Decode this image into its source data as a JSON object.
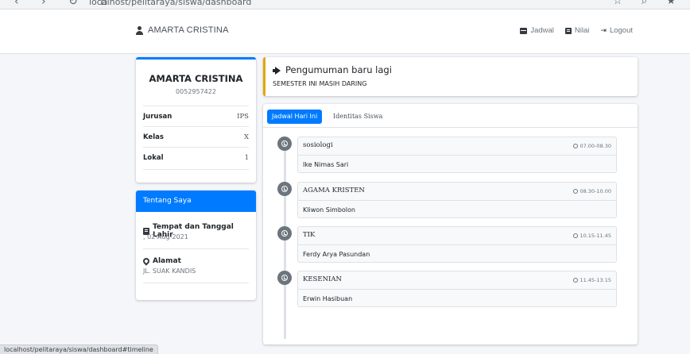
{
  "browser": {
    "nav_icons": "‹ › ↻ ⌂",
    "url": "localhost/pelitaraya/siswa/dashboard",
    "right_icons": "☆ ⌕ ★"
  },
  "navbar": {
    "brand": "AMARTA CRISTINA",
    "links": [
      {
        "label": "Jadwal",
        "icon": "calendar-icon"
      },
      {
        "label": "Nilai",
        "icon": "book-icon"
      },
      {
        "label": "Logout",
        "icon": "logout-icon",
        "glyph": "⇥"
      }
    ]
  },
  "profile": {
    "name": "AMARTA CRISTINA",
    "nis": "0052957422",
    "rows": [
      {
        "key": "Jurusan",
        "value": "IPS"
      },
      {
        "key": "Kelas",
        "value": "X"
      },
      {
        "key": "Lokal",
        "value": "1"
      }
    ]
  },
  "about": {
    "header": "Tentang Saya",
    "birth_title": "Tempat dan Tanggal Lahir",
    "birth_value": ", 02-Aug-2021",
    "address_title": "Alamat",
    "address_value": "JL. SUAK KANDIS"
  },
  "announcement": {
    "title": "Pengumuman baru lagi",
    "text": "SEMESTER INI MASIH DARING"
  },
  "tabs": {
    "active": "Jadwal Hari Ini",
    "inactive": "Identitas Siswa"
  },
  "schedule": [
    {
      "subject": "sosiologi",
      "time": "07.00-08.30",
      "teacher": "Ike Nimas Sari"
    },
    {
      "subject": "AGAMA KRISTEN",
      "time": "08.30-10.00",
      "teacher": "Kliwon Simbolon"
    },
    {
      "subject": "TIK",
      "time": "10.15-11.45",
      "teacher": "Ferdy Arya Pasundan"
    },
    {
      "subject": "KESENIAN",
      "time": "11.45-13.15",
      "teacher": "Erwin Hasibuan"
    }
  ],
  "status_bar": {
    "url": "localhost/pelitaraya/siswa/dashboard#timeline"
  },
  "colors": {
    "primary": "#007bff",
    "warning": "#e0a800",
    "background": "#f4f6f9"
  }
}
